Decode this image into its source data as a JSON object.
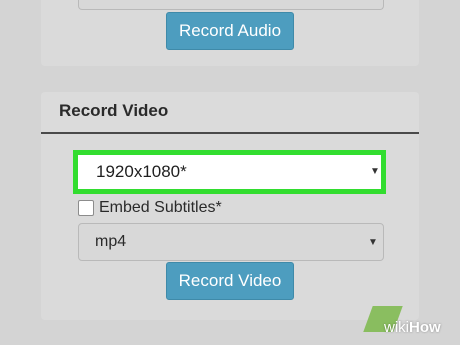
{
  "audio_section": {
    "record_button": "Record Audio"
  },
  "video_section": {
    "title": "Record Video",
    "resolution_select": {
      "value": "1920x1080*",
      "caret": "▼"
    },
    "subtitles": {
      "label": "Embed Subtitles*",
      "checked": false
    },
    "format_select": {
      "value": "mp4",
      "caret": "▼"
    },
    "record_button": "Record Video"
  },
  "watermark": {
    "prefix": "wiki",
    "suffix": "How"
  },
  "colors": {
    "button": "#4d9dbf",
    "highlight": "#32dd2f",
    "panel": "#dadada",
    "background": "#d4d4d4"
  }
}
